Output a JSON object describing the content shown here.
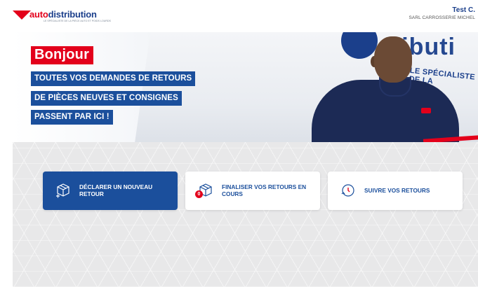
{
  "header": {
    "logo": {
      "prefix": "auto",
      "suffix": "distribution",
      "tagline": "LE SPÉCIALISTE DE LA PIÈCE AUTO ET POIDS LOURDS"
    },
    "user": {
      "name": "Test C.",
      "company": "SARL CARROSSERIE MICHEL"
    }
  },
  "hero": {
    "title": "Bonjour",
    "lines": [
      "TOUTES VOS DEMANDES DE RETOURS",
      "DE PIÈCES NEUVES ET CONSIGNES",
      "PASSENT PAR ICI !"
    ],
    "van_text": "ributi",
    "van_subtext": "LE SPÉCIALISTE DE LA"
  },
  "actions": [
    {
      "label": "DÉCLARER UN NOUVEAU RETOUR",
      "icon": "box-plus-icon",
      "active": true
    },
    {
      "label": "FINALISER VOS RETOURS EN COURS",
      "icon": "box-icon",
      "badge": "0",
      "active": false
    },
    {
      "label": "SUIVRE VOS RETOURS",
      "icon": "tracking-icon",
      "active": false
    }
  ],
  "colors": {
    "brand_blue": "#1b4f9c",
    "brand_red": "#e3001b",
    "background": "#e8e8e9"
  }
}
